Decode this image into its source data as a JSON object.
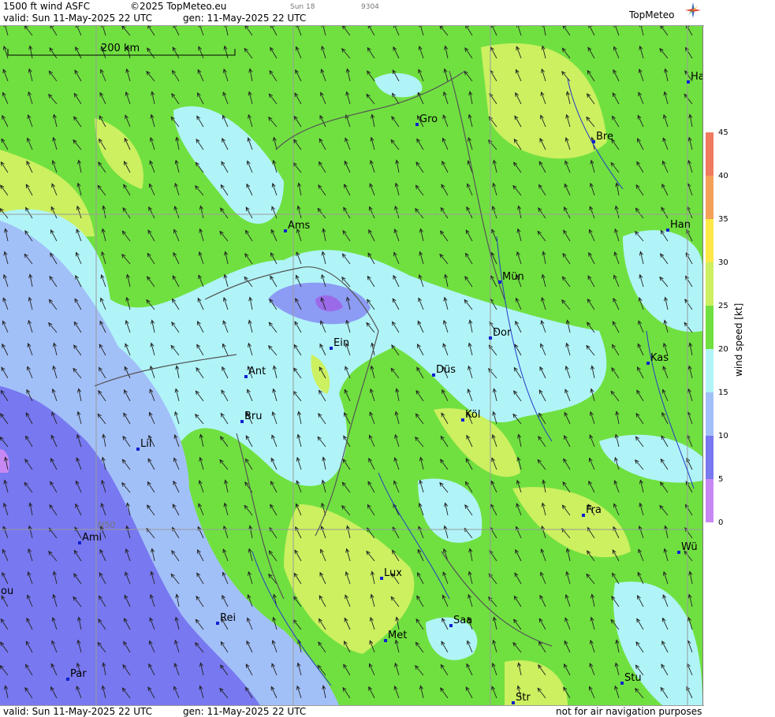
{
  "header": {
    "product": "1500 ft wind ASFC",
    "copyright": "©2025 TopMeteo.eu",
    "day_small": "Sun 18",
    "code_small": "9304",
    "valid": "valid:  Sun  11-May-2025  22 UTC",
    "gen": "gen: 11-May-2025 22 UTC",
    "brand": "TopMeteo"
  },
  "footer": {
    "valid": "valid:  Sun  11-May-2025  22 UTC",
    "gen": "gen: 11-May-2025 22 UTC",
    "disclaimer": "not for air navigation purposes"
  },
  "map": {
    "scale_label": "200 km",
    "lat_label": "N50",
    "cities": [
      "Ha",
      "Gro",
      "Bre",
      "Ams",
      "Han",
      "Mün",
      "Ein",
      "Dor",
      "Kas",
      "Ant",
      "Düs",
      "Köl",
      "Bru",
      "Lil",
      "Fra",
      "Ami",
      "Wü",
      "Lux",
      "ou",
      "Saa",
      "Rei",
      "Met",
      "Par",
      "Stu",
      "Str"
    ]
  },
  "legend": {
    "ticks": [
      "45",
      "40",
      "35",
      "30",
      "25",
      "20",
      "15",
      "10",
      "5",
      "0"
    ],
    "unit": "wind  speed  [kt]",
    "colors": [
      "#f07a60",
      "#f48a58",
      "#f8a850",
      "#fde848",
      "#ccf060",
      "#70e040",
      "#b0f4f8",
      "#a2c0f8",
      "#7878f0",
      "#c888f4"
    ]
  }
}
